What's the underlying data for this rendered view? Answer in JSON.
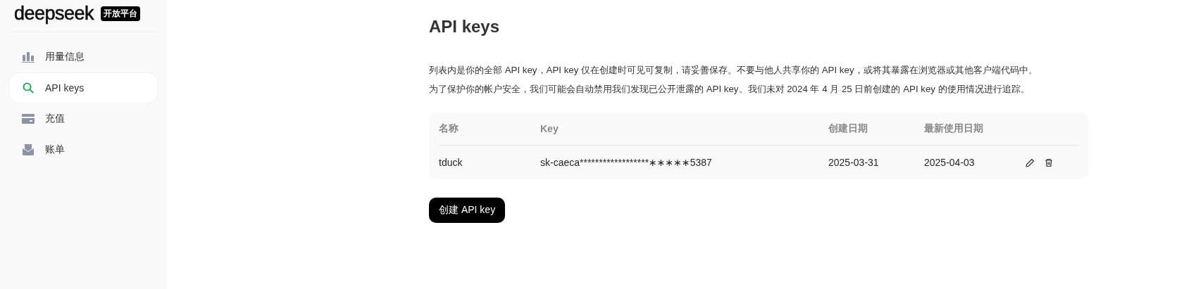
{
  "sidebar": {
    "logo": "deepseek",
    "badge": "开放平台",
    "items": [
      {
        "label": "用量信息",
        "kind": "chart",
        "selected": false
      },
      {
        "label": "API keys",
        "kind": "search",
        "selected": true
      },
      {
        "label": "充值",
        "kind": "card",
        "selected": false
      },
      {
        "label": "账单",
        "kind": "inbox",
        "selected": false
      }
    ]
  },
  "page": {
    "title": "API keys",
    "description": [
      "列表内是你的全部 API key，API key 仅在创建时可见可复制，请妥善保存。不要与他人共享你的 API key，或将其暴露在浏览器或其他客户端代码中。",
      "为了保护你的帐户安全，我们可能会自动禁用我们发现已公开泄露的 API key。我们未对 2024 年 4 月 25 日前创建的 API key 的使用情况进行追踪。"
    ]
  },
  "table": {
    "columns": [
      "名称",
      "Key",
      "创建日期",
      "最新使用日期"
    ],
    "rows": [
      {
        "cells": [
          "tduck",
          "sk-caeca******************∗∗∗∗∗5387",
          "2025-03-31",
          "2025-04-03"
        ]
      }
    ]
  },
  "create_button": "创建 API key"
}
